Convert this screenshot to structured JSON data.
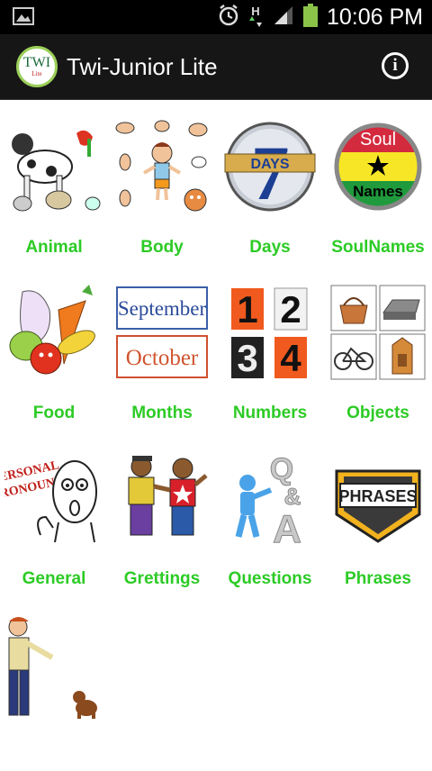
{
  "status": {
    "time": "10:06 PM",
    "signal_text": "H"
  },
  "app": {
    "title": "Twi-Junior Lite",
    "logo_main": "TWI",
    "logo_sub": "Lite",
    "info_glyph": "i"
  },
  "colors": {
    "label_green": "#2ccb25",
    "actionbar_bg": "#161616",
    "statusbar_bg": "#000000"
  },
  "categories": [
    {
      "label": "Animal",
      "icon": "animals-picture"
    },
    {
      "label": "Body",
      "icon": "body-parts-picture"
    },
    {
      "label": "Days",
      "icon": "seven-days-badge"
    },
    {
      "label": "SoulNames",
      "icon": "soul-names-badge"
    },
    {
      "label": "Food",
      "icon": "vegetables-picture"
    },
    {
      "label": "Months",
      "icon": "month-cards"
    },
    {
      "label": "Numbers",
      "icon": "number-tiles"
    },
    {
      "label": "Objects",
      "icon": "objects-picture"
    },
    {
      "label": "General",
      "icon": "personal-pronouns-picture"
    },
    {
      "label": "Grettings",
      "icon": "greeting-people-picture"
    },
    {
      "label": "Questions",
      "icon": "question-figure"
    },
    {
      "label": "Phrases",
      "icon": "phrases-sign"
    },
    {
      "label": "",
      "icon": "man-and-dog-picture"
    }
  ],
  "thumb_text": {
    "days_number": "7",
    "days_word": "DAYS",
    "soul_top": "Soul",
    "soul_bottom": "Names",
    "month_1": "September",
    "month_2": "October",
    "num_1": "1",
    "num_2": "2",
    "num_3": "3",
    "num_4": "4",
    "pronouns_line1": "PERSONAL",
    "pronouns_line2": "PRONOUNS",
    "phrases_word": "PHRASES",
    "q_letter": "Q",
    "amp": "&",
    "a_letter": "A"
  }
}
